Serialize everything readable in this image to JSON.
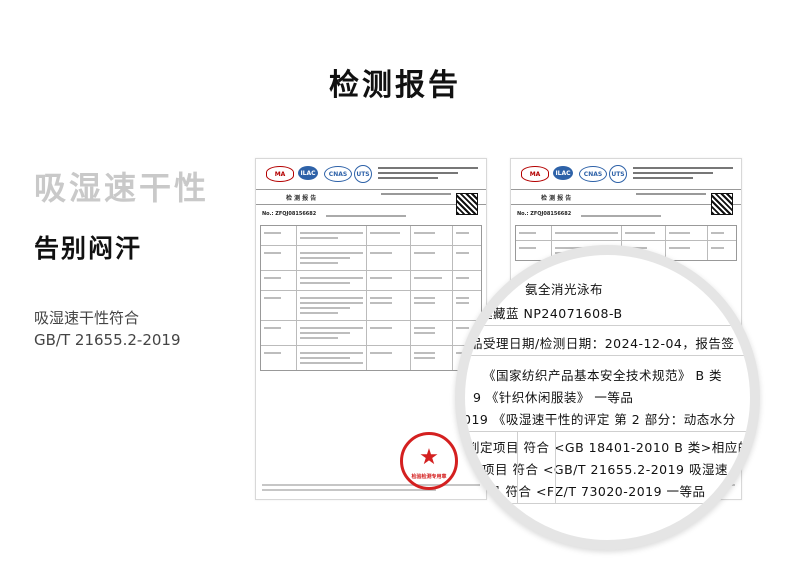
{
  "page_title": "检测报告",
  "left": {
    "feature_title": "吸湿速干性",
    "feature_subtitle": "告别闷汗",
    "desc_line1": "吸湿速干性符合",
    "desc_line2": "GB/T  21655.2-2019"
  },
  "report": {
    "heading": "检 测 报 告",
    "number": "No.: ZFQJ08156682"
  },
  "stamp_label": "检验检测专用章",
  "magnifier": {
    "line1": "氨全消光泳布",
    "line2": "鞑藏蓝  NP24071608-B",
    "line3": "品受理日期/检测日期：2024-12-04，报告签",
    "line4": "《国家纺织产品基本安全技术规范》  B 类",
    "line5": "9  《针织休闲服装》  一等品",
    "line6": "019  《吸湿速干性的评定  第 2 部分：动态水分",
    "line7": "判定项目  符合  <GB 18401-2010 B 类>相应的",
    "line8": "定项目  符合  <GB/T 21655.2-2019 吸湿速",
    "line9": "项目  符合  <FZ/T 73020-2019  一等品"
  }
}
